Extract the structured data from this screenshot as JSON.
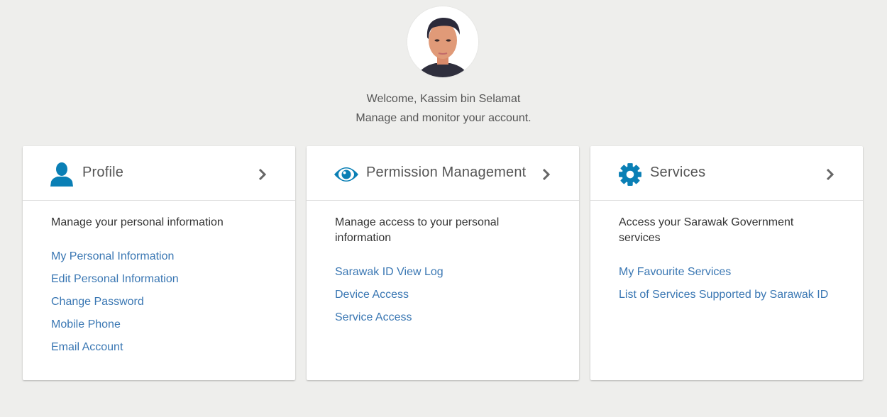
{
  "user": {
    "avatar_alt": "User profile photo",
    "welcome": "Welcome, Kassim bin Selamat",
    "subtitle": "Manage and monitor your account."
  },
  "colors": {
    "accent_icon": "#0a7fb5",
    "link": "#3a77b3",
    "background": "#eeeeec"
  },
  "cards": [
    {
      "title": "Profile",
      "icon": "user-icon",
      "description": "Manage your personal information",
      "links": [
        "My Personal Information",
        "Edit Personal Information",
        "Change Password",
        "Mobile Phone",
        "Email Account"
      ]
    },
    {
      "title": "Permission Management",
      "icon": "eye-icon",
      "description": "Manage access to your personal information",
      "links": [
        "Sarawak ID View Log",
        "Device Access",
        "Service Access"
      ]
    },
    {
      "title": "Services",
      "icon": "gear-icon",
      "description": "Access your Sarawak Government services",
      "links": [
        "My Favourite Services",
        "List of Services Supported by Sarawak ID"
      ]
    }
  ]
}
